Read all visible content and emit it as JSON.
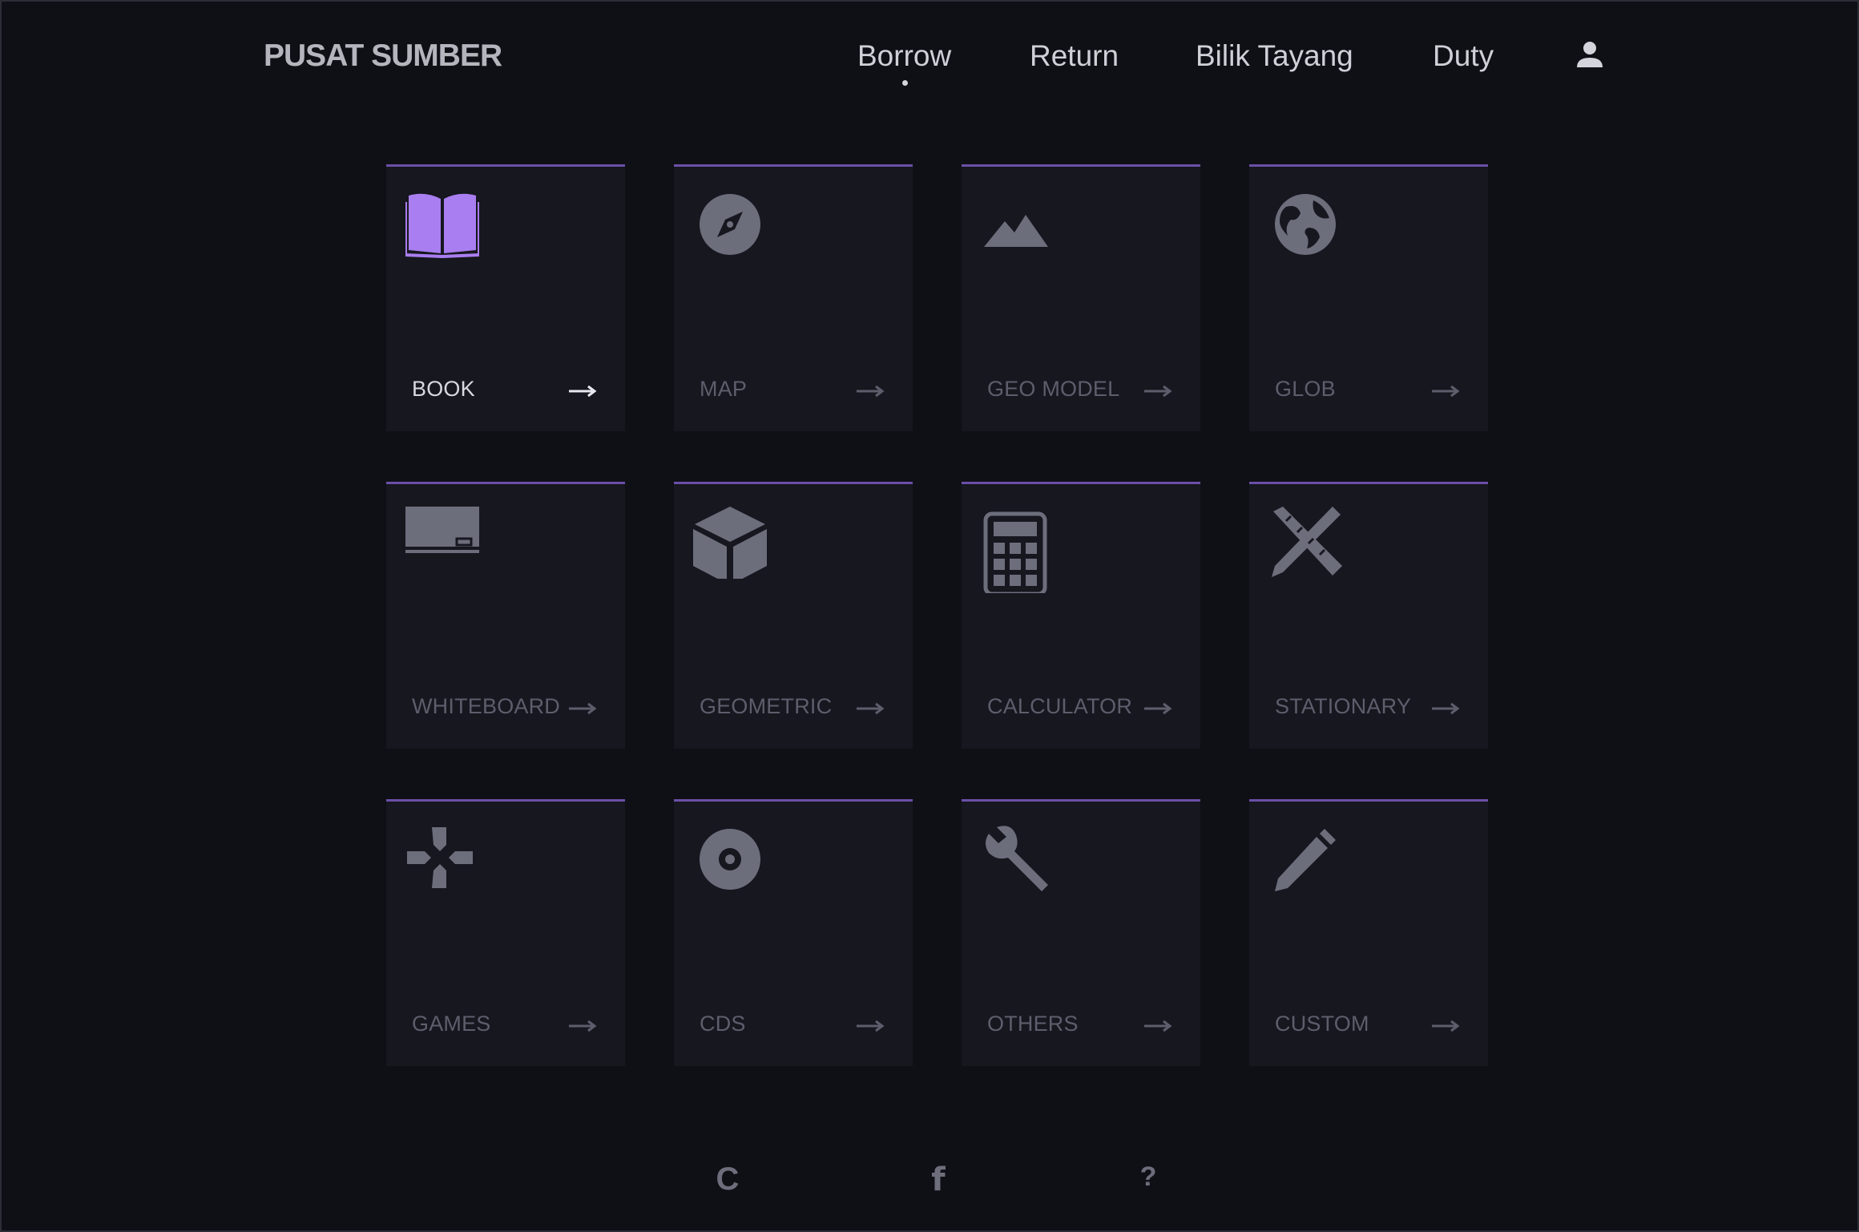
{
  "header": {
    "brand": "PUSAT SUMBER",
    "nav": [
      {
        "label": "Borrow",
        "active": true
      },
      {
        "label": "Return"
      },
      {
        "label": "Bilik Tayang"
      },
      {
        "label": "Duty"
      }
    ],
    "user_icon": "user-icon"
  },
  "cards": [
    {
      "label": "BOOK",
      "icon": "book-open-icon",
      "active": true
    },
    {
      "label": "MAP",
      "icon": "compass-icon"
    },
    {
      "label": "GEO MODEL",
      "icon": "mountain-icon"
    },
    {
      "label": "GLOB",
      "icon": "globe-icon"
    },
    {
      "label": "WHITEBOARD",
      "icon": "whiteboard-icon"
    },
    {
      "label": "GEOMETRIC",
      "icon": "cube-icon"
    },
    {
      "label": "CALCULATOR",
      "icon": "calculator-icon"
    },
    {
      "label": "STATIONARY",
      "icon": "ruler-pencil-icon"
    },
    {
      "label": "GAMES",
      "icon": "gamepad-icon"
    },
    {
      "label": "CDS",
      "icon": "disc-icon"
    },
    {
      "label": "OTHERS",
      "icon": "wrench-icon"
    },
    {
      "label": "CUSTOM",
      "icon": "pencil-icon"
    }
  ],
  "footer": {
    "c_label": "C",
    "f_label": "f",
    "help_label": "?"
  },
  "colors": {
    "background": "#0f1016",
    "card": "#16171f",
    "accent": "#6b4fa8",
    "active_icon": "#a97ef0",
    "icon": "#6d6e7c"
  }
}
